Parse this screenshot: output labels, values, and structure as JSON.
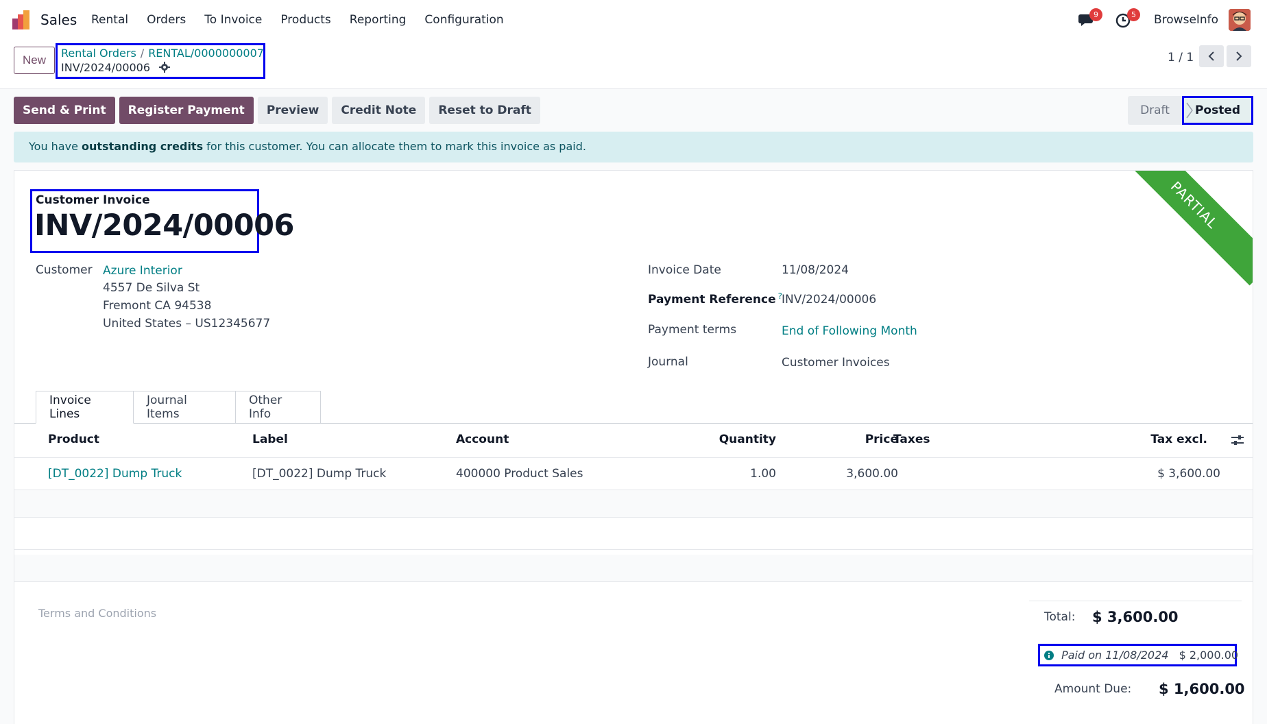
{
  "nav": {
    "app_name": "Sales",
    "menu": [
      "Rental",
      "Orders",
      "To Invoice",
      "Products",
      "Reporting",
      "Configuration"
    ],
    "messages_count": "9",
    "activities_count": "5",
    "company": "BrowseInfo"
  },
  "control_panel": {
    "new_label": "New",
    "breadcrumb": [
      "Rental Orders",
      "RENTAL/0000000007"
    ],
    "current": "INV/2024/00006",
    "pager": "1 / 1"
  },
  "actions": {
    "send_print": "Send & Print",
    "register_payment": "Register Payment",
    "preview": "Preview",
    "credit_note": "Credit Note",
    "reset_to_draft": "Reset to Draft"
  },
  "status": {
    "draft": "Draft",
    "posted": "Posted"
  },
  "alert": {
    "prefix": "You have ",
    "bold": "outstanding credits",
    "suffix": " for this customer. You can allocate them to mark this invoice as paid."
  },
  "ribbon": "PARTIAL",
  "invoice": {
    "type_label": "Customer Invoice",
    "number": "INV/2024/00006",
    "customer_label": "Customer",
    "customer_name": "Azure Interior",
    "address": [
      "4557 De Silva St",
      "Fremont CA 94538",
      "United States – US12345677"
    ],
    "invoice_date_label": "Invoice Date",
    "invoice_date": "11/08/2024",
    "payment_ref_label": "Payment Reference",
    "payment_ref_help": "?",
    "payment_ref": "INV/2024/00006",
    "payment_terms_label": "Payment terms",
    "payment_terms": "End of Following Month",
    "journal_label": "Journal",
    "journal": "Customer Invoices"
  },
  "tabs": [
    "Invoice Lines",
    "Journal Items",
    "Other Info"
  ],
  "table": {
    "headers": [
      "Product",
      "Label",
      "Account",
      "Quantity",
      "Price",
      "Taxes",
      "Tax excl."
    ],
    "rows": [
      {
        "product": "[DT_0022] Dump Truck",
        "label": "[DT_0022] Dump Truck",
        "account": "400000 Product Sales",
        "quantity": "1.00",
        "price": "3,600.00",
        "taxes": "",
        "subtotal": "$ 3,600.00"
      }
    ]
  },
  "footer": {
    "terms_placeholder": "Terms and Conditions",
    "total_label": "Total:",
    "total": "$ 3,600.00",
    "paid_text": "Paid on 11/08/2024",
    "paid_amount": "$ 2,000.00",
    "amount_due_label": "Amount Due:",
    "amount_due": "$ 1,600.00"
  },
  "colors": {
    "primary": "#714b67",
    "link": "#017e84",
    "ribbon": "#3fa53a",
    "alert_bg": "#d7eef1",
    "highlight_border": "#0000ee"
  }
}
